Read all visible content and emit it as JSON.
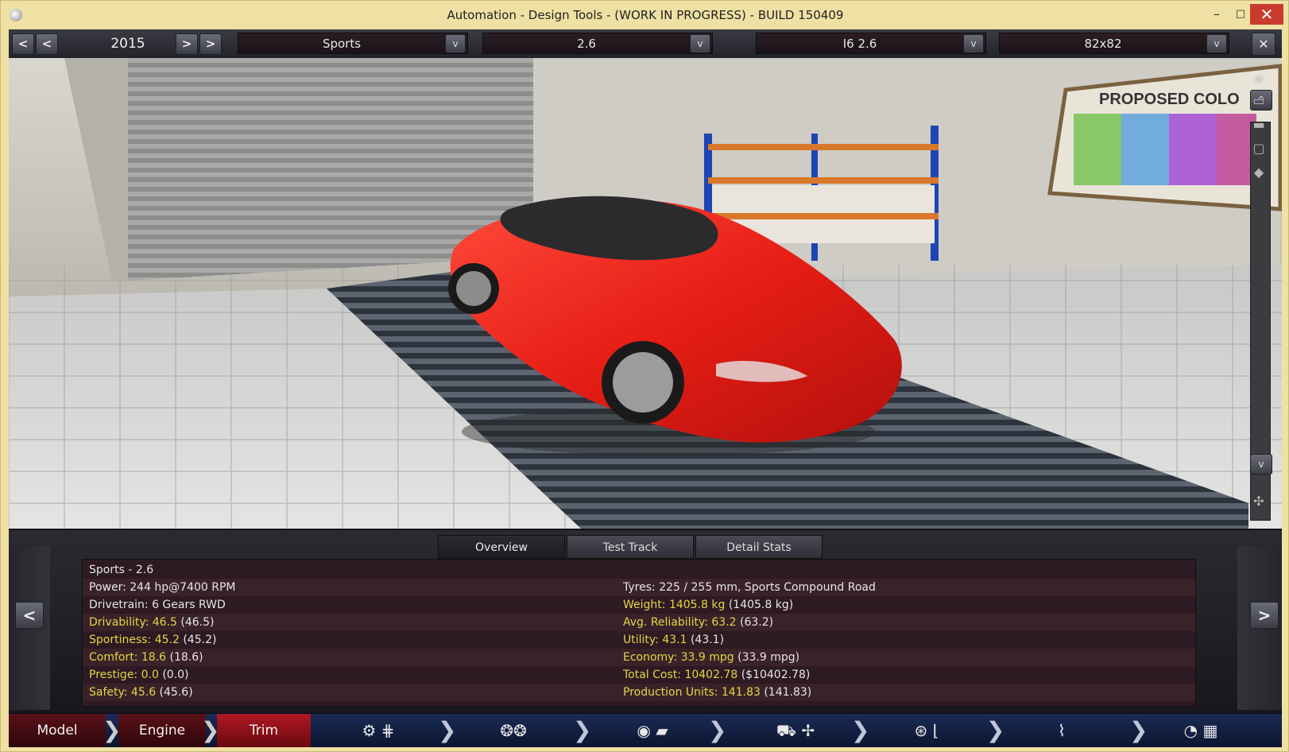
{
  "window": {
    "title": "Automation - Design Tools - (WORK IN PROGRESS) - BUILD 150409",
    "min": "–",
    "max": "□",
    "close": "✕"
  },
  "topbar": {
    "prev_fast": "<",
    "prev": "<",
    "year": "2015",
    "next": ">",
    "next_fast": ">",
    "body_style": "Sports",
    "variant": "2.6",
    "engine": "I6 2.6",
    "engine_variant": "82x82",
    "dropdown": "v",
    "close": "✕"
  },
  "viewport": {
    "colors": {
      "car": "#e6201a",
      "shelf_orange": "#d9782b",
      "shelf_blue": "#1f44b4"
    },
    "poster_text": "PROPOSED COLO",
    "scroll_up": "^",
    "scroll_down": "v",
    "camera_icons": [
      "camera-icon",
      "car-side-icon",
      "car-side-icon",
      "car-front-icon",
      "car-top-icon"
    ]
  },
  "panel": {
    "tabs": [
      "Overview",
      "Test Track",
      "Detail Stats"
    ],
    "active_tab": 0,
    "prev": "<",
    "next": ">",
    "title": "Sports - 2.6",
    "left": [
      {
        "label": "Power: ",
        "value": "244 hp@7400 RPM",
        "highlight": false
      },
      {
        "label": "Drivetrain: ",
        "value": "6 Gears RWD",
        "highlight": false
      },
      {
        "label": "Drivability: 46.5",
        "value": " (46.5)",
        "highlight": true
      },
      {
        "label": "Sportiness: 45.2",
        "value": " (45.2)",
        "highlight": true
      },
      {
        "label": "Comfort: 18.6",
        "value": " (18.6)",
        "highlight": true
      },
      {
        "label": "Prestige: 0.0",
        "value": " (0.0)",
        "highlight": true
      },
      {
        "label": "Safety: 45.6",
        "value": " (45.6)",
        "highlight": true
      }
    ],
    "right": [
      {
        "label": "Tyres: ",
        "value": "225 / 255 mm, Sports Compound Road",
        "highlight": false
      },
      {
        "label": "Weight: 1405.8 kg",
        "value": " (1405.8 kg)",
        "highlight": true
      },
      {
        "label": "Avg. Reliability: 63.2",
        "value": " (63.2)",
        "highlight": true
      },
      {
        "label": "Utility: 43.1",
        "value": " (43.1)",
        "highlight": true
      },
      {
        "label": "Economy: 33.9 mpg",
        "value": " (33.9 mpg)",
        "highlight": true
      },
      {
        "label": "Total Cost: 10402.78",
        "value": " ($10402.78)",
        "highlight": true
      },
      {
        "label": "Production Units: 141.83",
        "value": " (141.83)",
        "highlight": true
      }
    ]
  },
  "bottombar": {
    "model": "Model",
    "engine": "Engine",
    "trim": "Trim",
    "chevron": "❯",
    "icons": [
      "gearbox-icon",
      "wheels-icon",
      "brakes-body-icon",
      "aero-cooling-icon",
      "interior-seat-icon",
      "suspension-icon",
      "test-drive-icon"
    ]
  }
}
